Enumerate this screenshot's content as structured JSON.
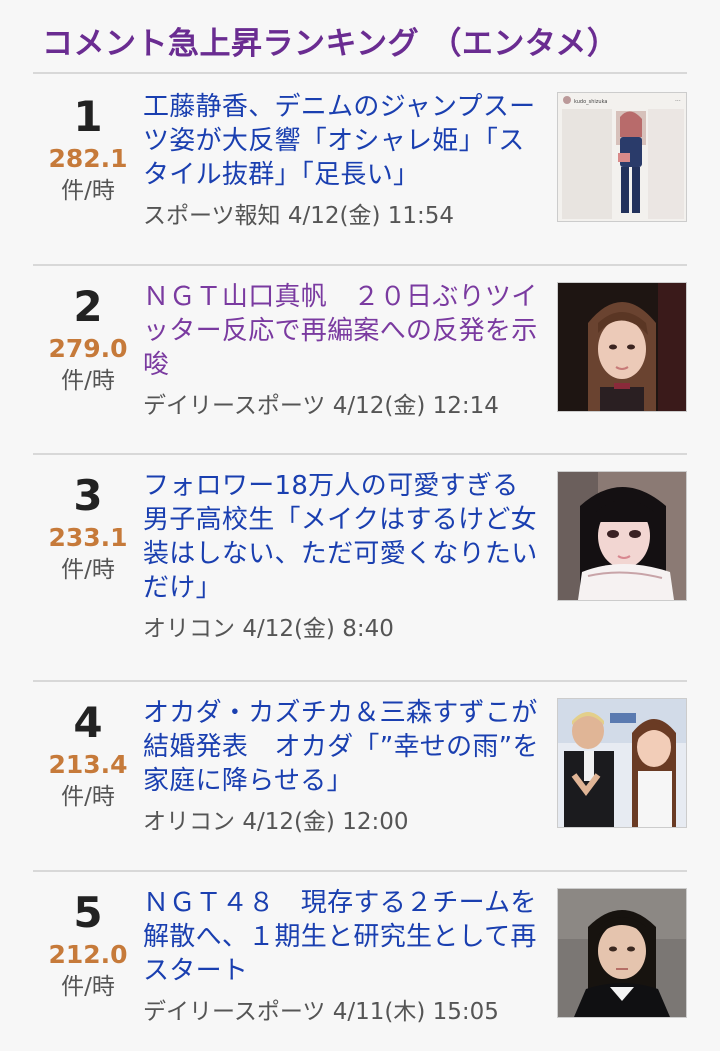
{
  "header": {
    "title": "コメント急上昇ランキング （エンタメ）"
  },
  "items": [
    {
      "rank": "1",
      "score": "282.1",
      "unit": "件/時",
      "title": "工藤静香、デニムのジャンプスーツ姿が大反響「オシャレ姫」「スタイル抜群」「足長い」",
      "source": "スポーツ報知",
      "date": "4/12(金) 11:54",
      "thumb_caption": "kudo_shizuka"
    },
    {
      "rank": "2",
      "score": "279.0",
      "unit": "件/時",
      "title": "ＮＧＴ山口真帆　２０日ぶりツイッター反応で再編案への反発を示唆",
      "source": "デイリースポーツ",
      "date": "4/12(金) 12:14"
    },
    {
      "rank": "3",
      "score": "233.1",
      "unit": "件/時",
      "title": "フォロワー18万人の可愛すぎる男子高校生「メイクはするけど女装はしない、ただ可愛くなりたいだけ」",
      "source": "オリコン",
      "date": "4/12(金) 8:40"
    },
    {
      "rank": "4",
      "score": "213.4",
      "unit": "件/時",
      "title": "オカダ・カズチカ＆三森すずこが結婚発表　オカダ「”幸せの雨”を家庭に降らせる」",
      "source": "オリコン",
      "date": "4/12(金) 12:00"
    },
    {
      "rank": "5",
      "score": "212.0",
      "unit": "件/時",
      "title": "ＮＧＴ４８　現存する２チームを解散へ、１期生と研究生として再スタート",
      "source": "デイリースポーツ",
      "date": "4/11(木) 15:05"
    }
  ]
}
